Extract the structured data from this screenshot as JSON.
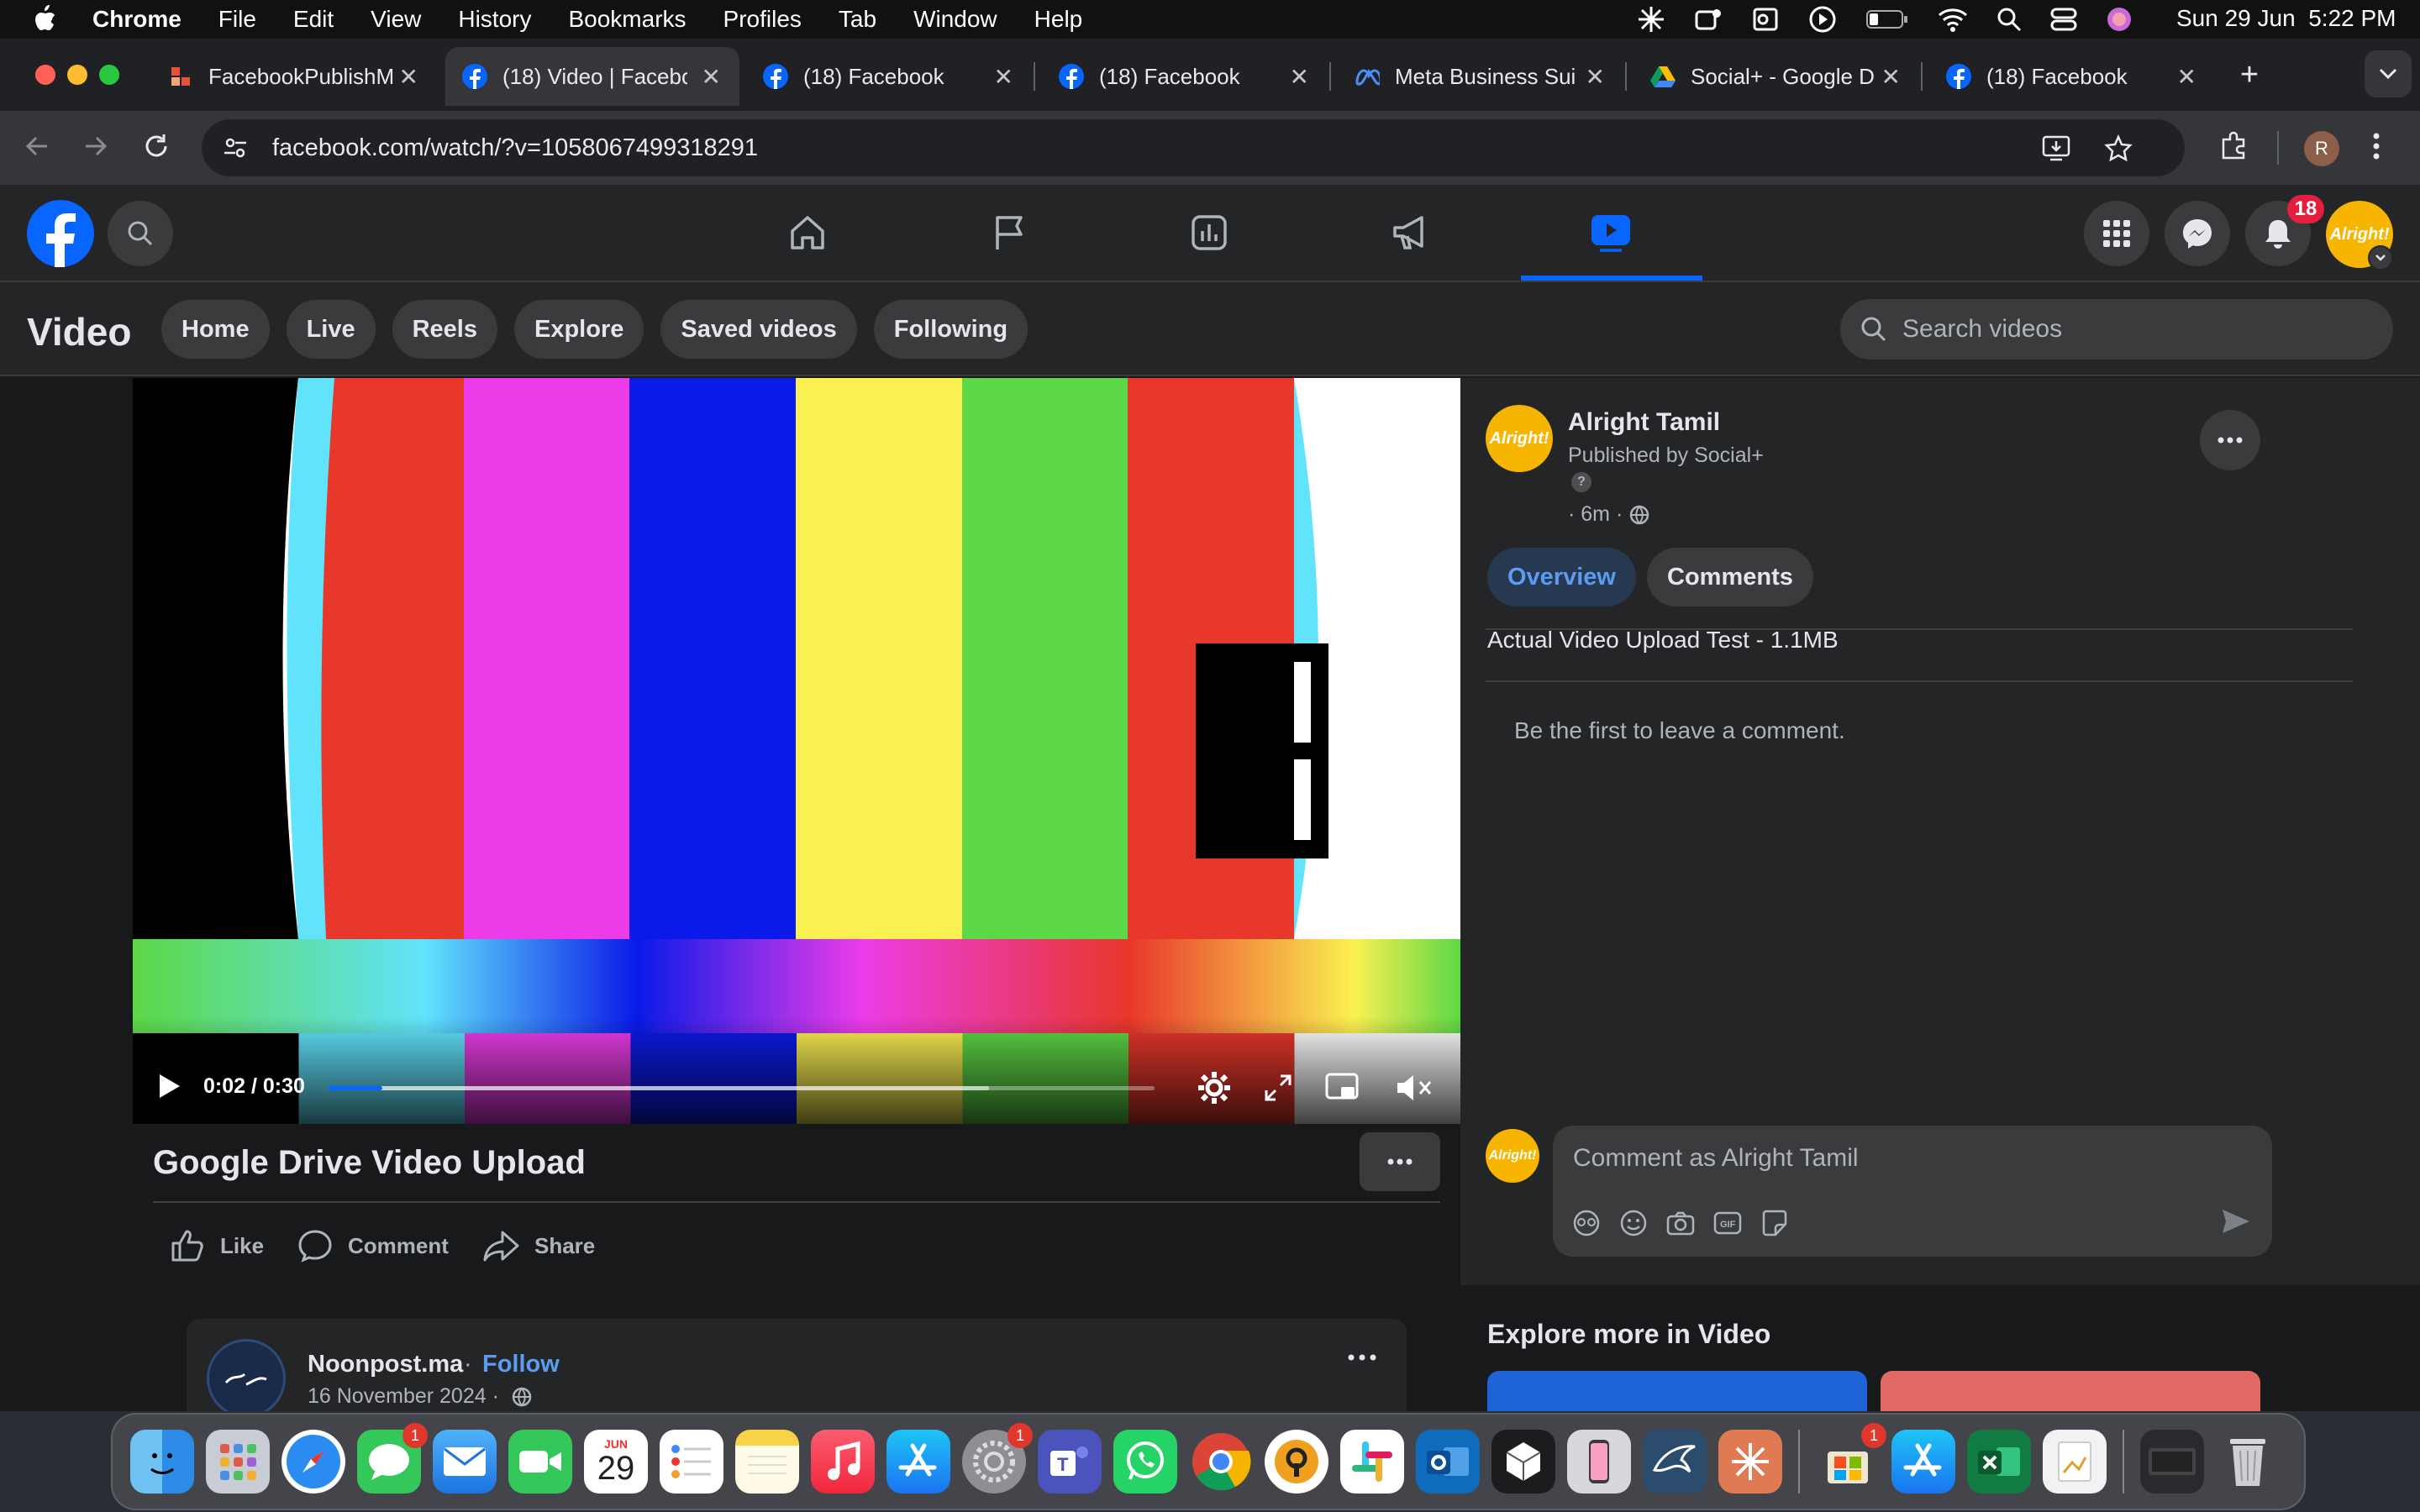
{
  "menubar": {
    "app": "Chrome",
    "items": [
      "File",
      "Edit",
      "View",
      "History",
      "Bookmarks",
      "Profiles",
      "Tab",
      "Window",
      "Help"
    ],
    "datetime": "Sun 29 Jun  5:22 PM"
  },
  "tabs": [
    {
      "label": "FacebookPublishM",
      "icon": "facebookpublish-favicon"
    },
    {
      "label": "(18) Video | Facebo",
      "icon": "facebook-icon",
      "active": true
    },
    {
      "label": "(18) Facebook",
      "icon": "facebook-icon"
    },
    {
      "label": "(18) Facebook",
      "icon": "facebook-icon"
    },
    {
      "label": "Meta Business Sui",
      "icon": "meta-icon"
    },
    {
      "label": "Social+ - Google D",
      "icon": "google-drive-icon"
    },
    {
      "label": "(18) Facebook",
      "icon": "facebook-icon"
    }
  ],
  "address": {
    "url": "facebook.com/watch/?v=1058067499318291"
  },
  "profile_initial": "R",
  "fb": {
    "notification_count": "18",
    "avatar_text": "Alright!"
  },
  "video_section": {
    "title": "Video",
    "pills": [
      "Home",
      "Live",
      "Reels",
      "Explore",
      "Saved videos",
      "Following"
    ],
    "search_placeholder": "Search videos"
  },
  "player": {
    "time": "0:02 / 0:30",
    "progress_fraction": 0.066,
    "buffered_fraction": 0.8
  },
  "post": {
    "title": "Google Drive Video Upload",
    "actions": {
      "like": "Like",
      "comment": "Comment",
      "share": "Share"
    }
  },
  "publisher": {
    "name": "Alright Tamil",
    "published_by": "Published by Social+",
    "time": "· 6m ·"
  },
  "panel_tabs": {
    "overview": "Overview",
    "comments": "Comments"
  },
  "description": "Actual Video Upload Test - 1.1MB",
  "empty_comments": "Be the first to leave a comment.",
  "comment_box": {
    "placeholder": "Comment as Alright Tamil"
  },
  "next_post": {
    "name": "Noonpost.ma",
    "follow": "Follow",
    "date": "16 November 2024 ·"
  },
  "explore_title": "Explore more in Video",
  "dock": {
    "calendar_month": "JUN",
    "calendar_day": "29",
    "badges": {
      "messages": "1",
      "settings": "1",
      "app": "1"
    }
  },
  "colors": {
    "fb_blue": "#0866ff",
    "accent_text": "#5b9cf0",
    "red_badge": "#e41e3f"
  }
}
